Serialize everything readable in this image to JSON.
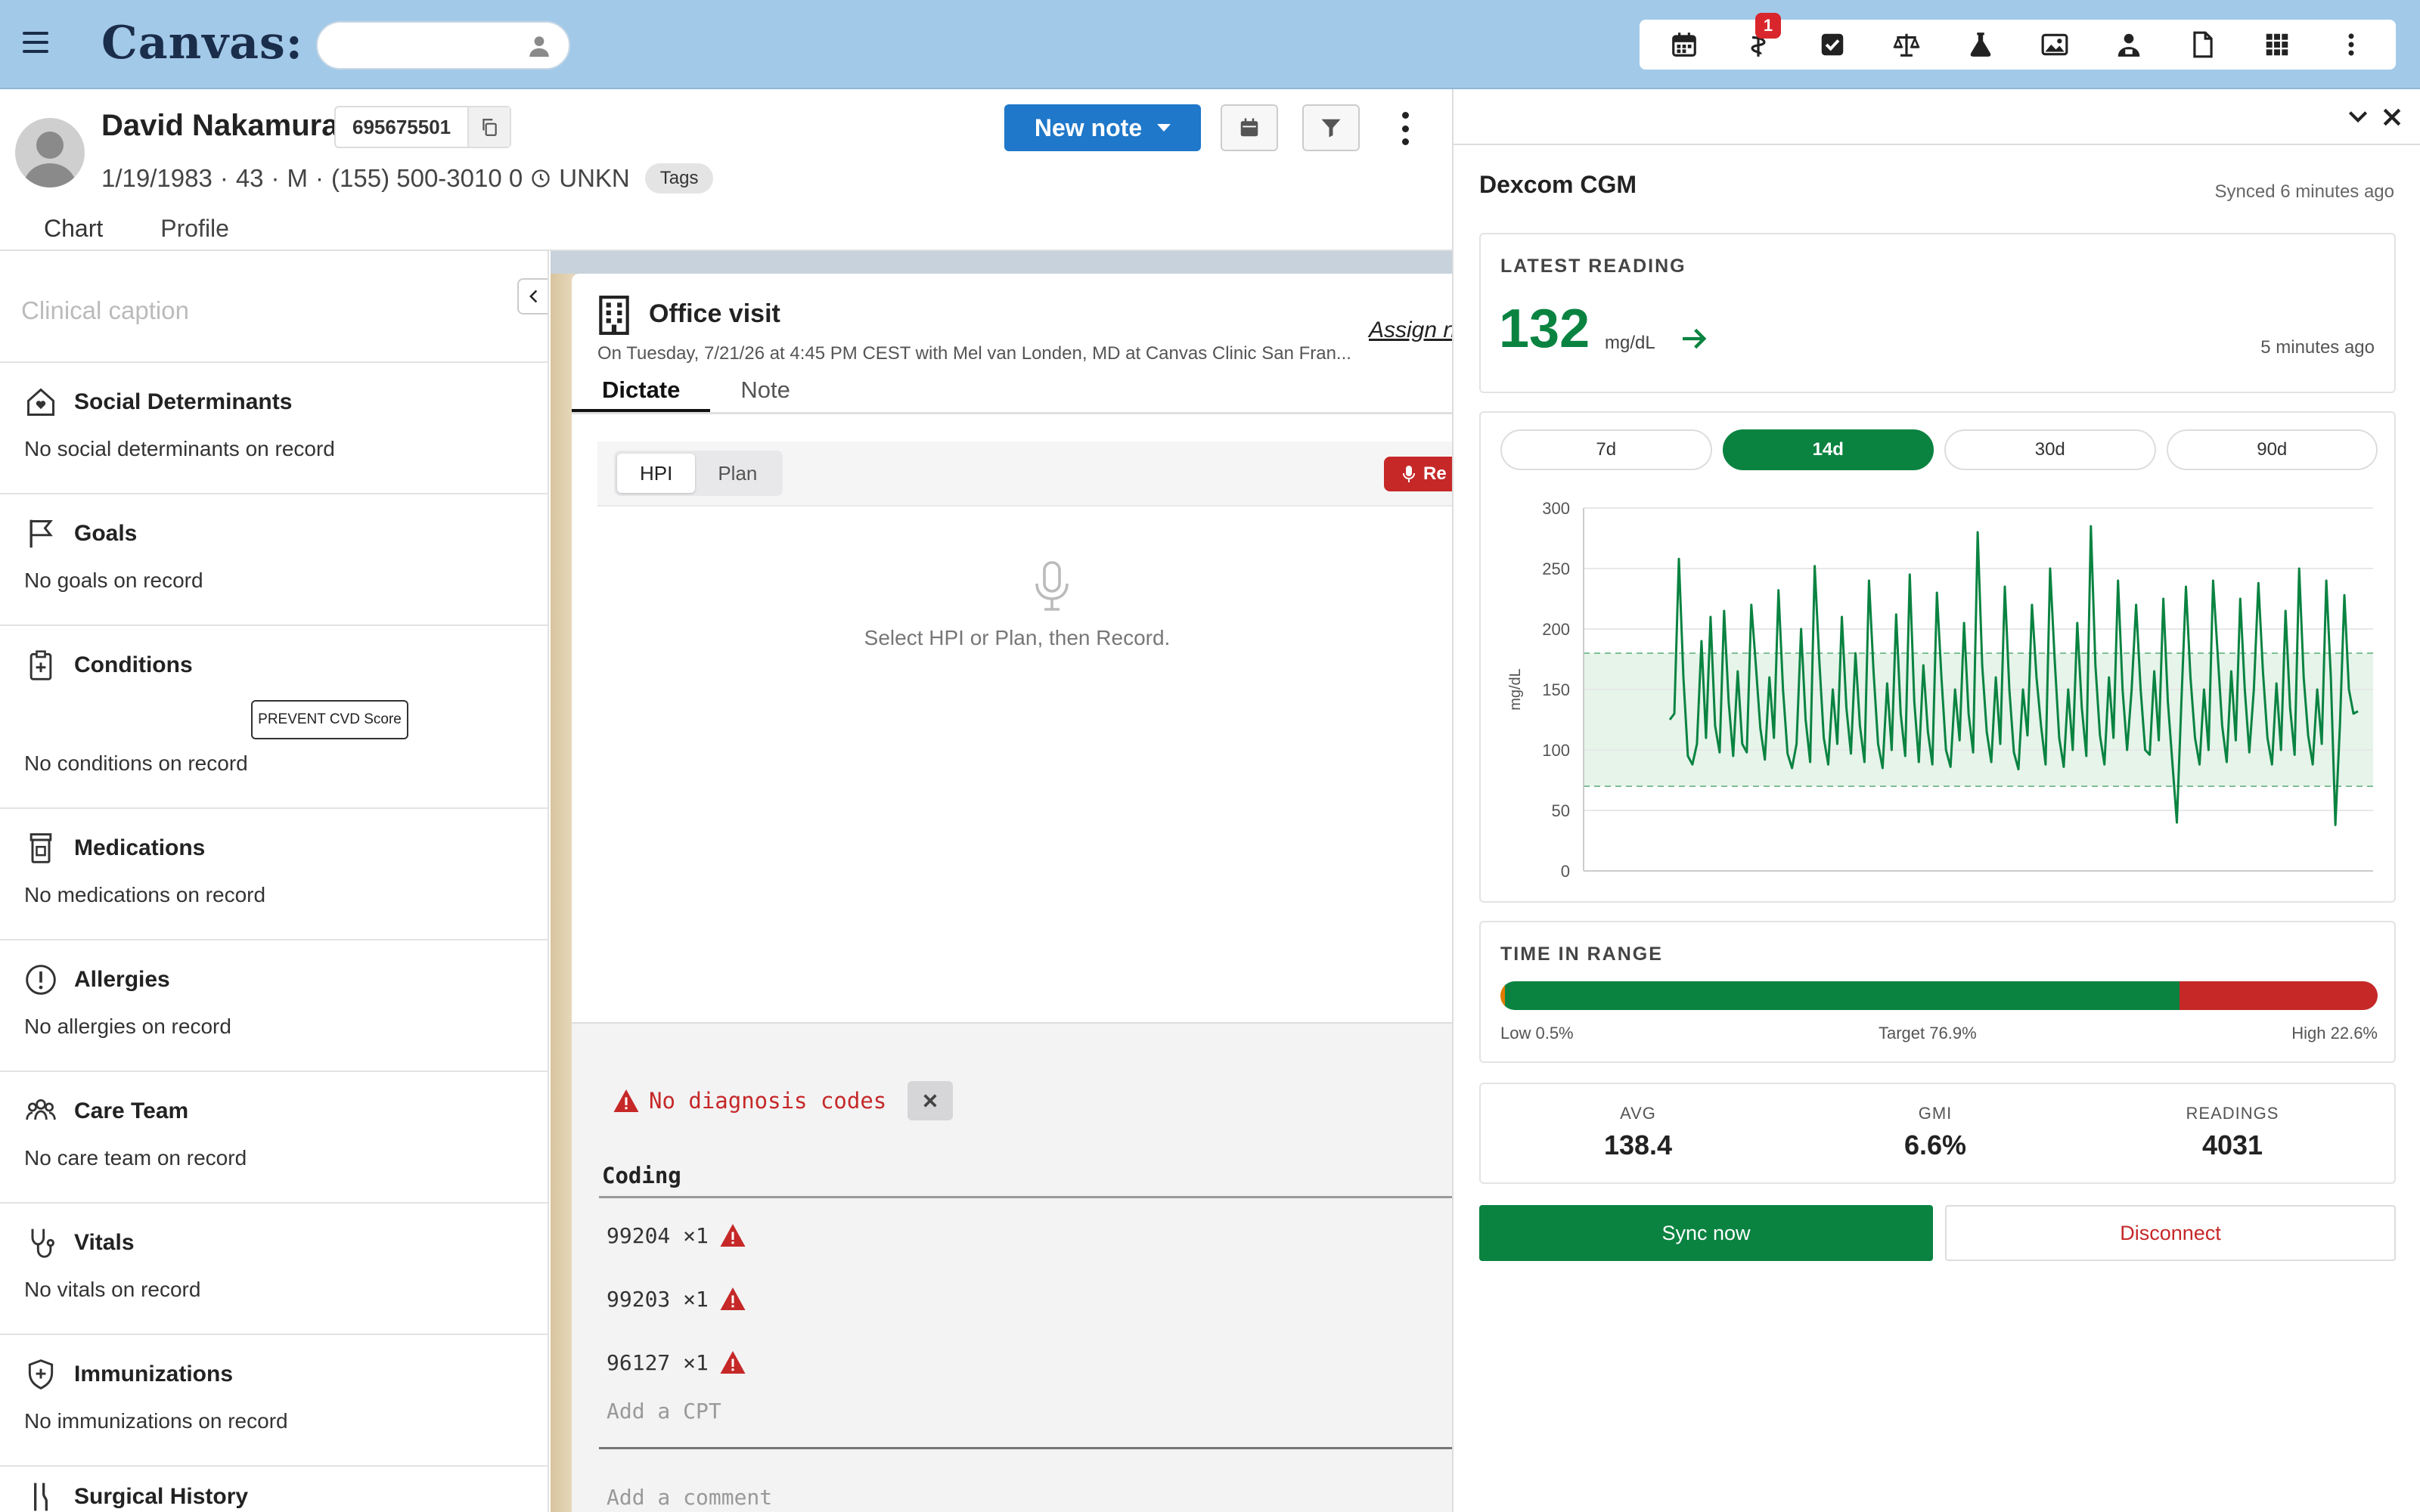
{
  "app": {
    "logo": "Canvas:",
    "search_placeholder": "",
    "toolbar": {
      "icons": [
        "calendar-icon",
        "caduceus-icon",
        "checkbox-icon",
        "scale-icon",
        "flask-icon",
        "image-icon",
        "provider-icon",
        "document-icon",
        "apps-grid-icon",
        "more-vert-icon"
      ],
      "notification_count": "1"
    }
  },
  "patient": {
    "name": "David Nakamura",
    "mrn": "695675501",
    "dob": "1/19/1983",
    "age": "43",
    "sex": "M",
    "phone": "(155) 500-3010 0",
    "timezone": "UNKN",
    "tags_label": "Tags",
    "new_note_label": "New note",
    "tabs": [
      {
        "label": "Chart",
        "active": true
      },
      {
        "label": "Profile",
        "active": false
      }
    ]
  },
  "sidebar": {
    "caption_placeholder": "Clinical caption",
    "sections": [
      {
        "title": "Social Determinants",
        "empty": "No social determinants on record",
        "icon": "house-heart-icon"
      },
      {
        "title": "Goals",
        "empty": "No goals on record",
        "icon": "flag-icon"
      },
      {
        "title": "Conditions",
        "empty": "No conditions on record",
        "icon": "clipboard-plus-icon",
        "action": "PREVENT CVD Score"
      },
      {
        "title": "Medications",
        "empty": "No medications on record",
        "icon": "pill-bottle-icon"
      },
      {
        "title": "Allergies",
        "empty": "No allergies on record",
        "icon": "alert-circle-icon"
      },
      {
        "title": "Care Team",
        "empty": "No care team on record",
        "icon": "people-icon"
      },
      {
        "title": "Vitals",
        "empty": "No vitals on record",
        "icon": "stethoscope-icon"
      },
      {
        "title": "Immunizations",
        "empty": "No immunizations on record",
        "icon": "shield-plus-icon"
      },
      {
        "title": "Surgical History",
        "empty": "",
        "icon": "surgical-icon"
      }
    ]
  },
  "note": {
    "title": "Office visit",
    "assign_label": "Assign n",
    "subtitle": "On Tuesday, 7/21/26 at 4:45 PM CEST with Mel van Londen, MD at Canvas Clinic San Fran...",
    "tabs": [
      {
        "label": "Dictate",
        "active": true
      },
      {
        "label": "Note",
        "active": false
      }
    ],
    "dictate": {
      "segments": [
        {
          "label": "HPI",
          "active": true
        },
        {
          "label": "Plan",
          "active": false
        }
      ],
      "record_label": "Re",
      "hint": "Select HPI or Plan, then Record."
    },
    "coding": {
      "no_dx": "No diagnosis codes",
      "title": "Coding",
      "cpts": [
        "99204 ×1",
        "99203 ×1",
        "96127 ×1"
      ],
      "add_cpt_placeholder": "Add a CPT",
      "add_comment_placeholder": "Add a comment"
    }
  },
  "cgm": {
    "title": "Dexcom CGM",
    "synced": "Synced 6 minutes ago",
    "latest_label": "LATEST READING",
    "latest_value": "132",
    "latest_unit": "mg/dL",
    "latest_time": "5 minutes ago",
    "ranges": [
      {
        "label": "7d",
        "active": false
      },
      {
        "label": "14d",
        "active": true
      },
      {
        "label": "30d",
        "active": false
      },
      {
        "label": "90d",
        "active": false
      }
    ],
    "tir_label": "TIME IN RANGE",
    "tir": {
      "low_pct": 0.5,
      "target_pct": 76.9,
      "high_pct": 22.6,
      "low_label": "Low 0.5%",
      "target_label": "Target 76.9%",
      "high_label": "High 22.6%"
    },
    "stats": [
      {
        "label": "AVG",
        "value": "138.4"
      },
      {
        "label": "GMI",
        "value": "6.6%"
      },
      {
        "label": "READINGS",
        "value": "4031"
      }
    ],
    "sync_label": "Sync now",
    "disconnect_label": "Disconnect",
    "colors": {
      "green": "#0a8341",
      "red": "#c62828",
      "low": "#e07b00",
      "band": "#e6f4ea"
    }
  },
  "chart_data": {
    "type": "line",
    "title": "",
    "xlabel": "",
    "ylabel": "mg/dL",
    "ylim": [
      0,
      300
    ],
    "yticks": [
      0,
      50,
      100,
      150,
      200,
      250,
      300
    ],
    "target_range": [
      70,
      180
    ],
    "grid": true,
    "series": [
      {
        "values": [
          125,
          130,
          258,
          160,
          95,
          88,
          105,
          190,
          110,
          210,
          120,
          98,
          215,
          140,
          95,
          165,
          105,
          98,
          220,
          170,
          118,
          92,
          160,
          110,
          232,
          150,
          97,
          85,
          105,
          200,
          125,
          90,
          252,
          175,
          110,
          88,
          150,
          105,
          210,
          135,
          97,
          180,
          120,
          90,
          240,
          165,
          105,
          85,
          155,
          100,
          212,
          130,
          95,
          245,
          140,
          90,
          170,
          115,
          88,
          230,
          160,
          100,
          86,
          150,
          108,
          205,
          130,
          98,
          280,
          170,
          115,
          90,
          160,
          105,
          235,
          150,
          98,
          84,
          150,
          112,
          220,
          160,
          120,
          88,
          250,
          175,
          110,
          86,
          150,
          100,
          205,
          135,
          95,
          285,
          170,
          112,
          88,
          160,
          110,
          240,
          150,
          100,
          150,
          220,
          150,
          100,
          96,
          165,
          108,
          225,
          140,
          90,
          40,
          140,
          235,
          160,
          110,
          88,
          150,
          100,
          240,
          180,
          120,
          90,
          165,
          108,
          225,
          150,
          98,
          150,
          238,
          165,
          110,
          88,
          155,
          100,
          215,
          135,
          96,
          250,
          160,
          112,
          88,
          150,
          105,
          240,
          160,
          38,
          120,
          228,
          150,
          130,
          132
        ]
      }
    ]
  }
}
